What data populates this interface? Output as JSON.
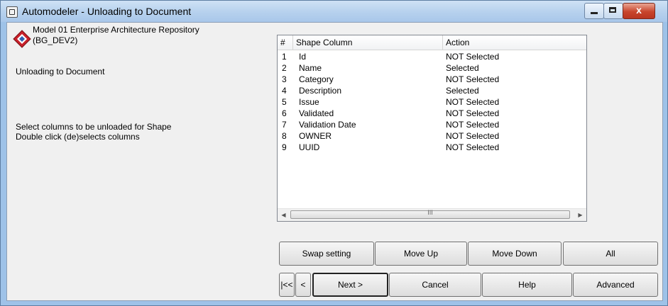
{
  "window": {
    "title": "Automodeler - Unloading to Document",
    "close_glyph": "x"
  },
  "header": {
    "repo_line1": "Model 01 Enterprise Architecture Repository",
    "repo_line2": "(BG_DEV2)"
  },
  "subtitle": "Unloading to Document",
  "instructions": {
    "line1": "Select columns to be unloaded for Shape",
    "line2": "Double click (de)selects columns"
  },
  "table": {
    "columns": [
      "#",
      "Shape Column",
      "Action"
    ],
    "rows": [
      {
        "num": "1",
        "column": "Id",
        "action": "NOT Selected"
      },
      {
        "num": "2",
        "column": "Name",
        "action": "Selected"
      },
      {
        "num": "3",
        "column": "Category",
        "action": "NOT Selected"
      },
      {
        "num": "4",
        "column": "Description",
        "action": "Selected"
      },
      {
        "num": "5",
        "column": "Issue",
        "action": "NOT Selected"
      },
      {
        "num": "6",
        "column": "Validated",
        "action": "NOT Selected"
      },
      {
        "num": "7",
        "column": "Validation Date",
        "action": "NOT Selected"
      },
      {
        "num": "8",
        "column": "OWNER",
        "action": "NOT Selected"
      },
      {
        "num": "9",
        "column": "UUID",
        "action": "NOT Selected"
      }
    ],
    "scroll_grip": "III"
  },
  "buttons": {
    "swap": "Swap setting",
    "move_up": "Move Up",
    "move_down": "Move Down",
    "all": "All",
    "first": "|<<",
    "prev": "<",
    "next": "Next >",
    "cancel": "Cancel",
    "help": "Help",
    "advanced": "Advanced"
  },
  "icons": {
    "app": "app-window-icon",
    "logo": "repository-diamond-logo",
    "scroll_left": "triangle-left",
    "scroll_right": "triangle-right"
  },
  "colors": {
    "title_bar": "#b8d2ee",
    "close_button": "#c8452c",
    "logo_red": "#c8202a",
    "logo_blue": "#2f5fb0"
  }
}
